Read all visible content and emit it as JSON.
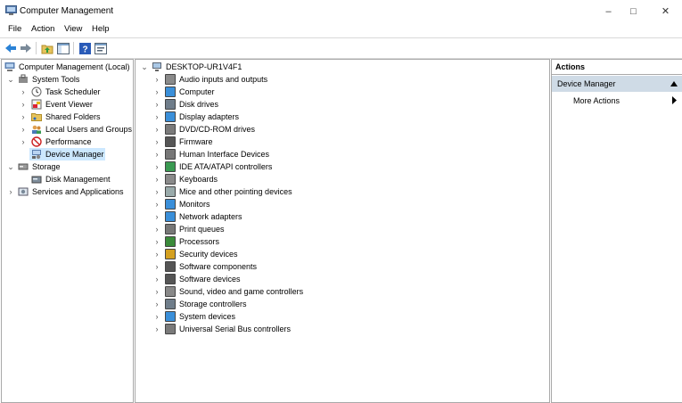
{
  "window": {
    "title": "Computer Management"
  },
  "menu": [
    "File",
    "Action",
    "View",
    "Help"
  ],
  "toolbar_icons": [
    "back-arrow-icon",
    "forward-arrow-icon",
    "up-folder-icon",
    "show-hide-tree-icon",
    "help-icon",
    "properties-icon"
  ],
  "tree": {
    "root": "Computer Management (Local)",
    "system_tools": "System Tools",
    "task_scheduler": "Task Scheduler",
    "event_viewer": "Event Viewer",
    "shared_folders": "Shared Folders",
    "local_users_groups": "Local Users and Groups",
    "performance": "Performance",
    "device_manager": "Device Manager",
    "storage": "Storage",
    "disk_management": "Disk Management",
    "services_apps": "Services and Applications"
  },
  "devices": {
    "computer_name": "DESKTOP-UR1V4F1",
    "categories": [
      "Audio inputs and outputs",
      "Computer",
      "Disk drives",
      "Display adapters",
      "DVD/CD-ROM drives",
      "Firmware",
      "Human Interface Devices",
      "IDE ATA/ATAPI controllers",
      "Keyboards",
      "Mice and other pointing devices",
      "Monitors",
      "Network adapters",
      "Print queues",
      "Processors",
      "Security devices",
      "Software components",
      "Software devices",
      "Sound, video and game controllers",
      "Storage controllers",
      "System devices",
      "Universal Serial Bus controllers"
    ]
  },
  "actions": {
    "header": "Actions",
    "section": "Device Manager",
    "more": "More Actions"
  },
  "colors": {
    "selection": "#cce8ff",
    "actions_section_bg": "#cfdbe6"
  }
}
